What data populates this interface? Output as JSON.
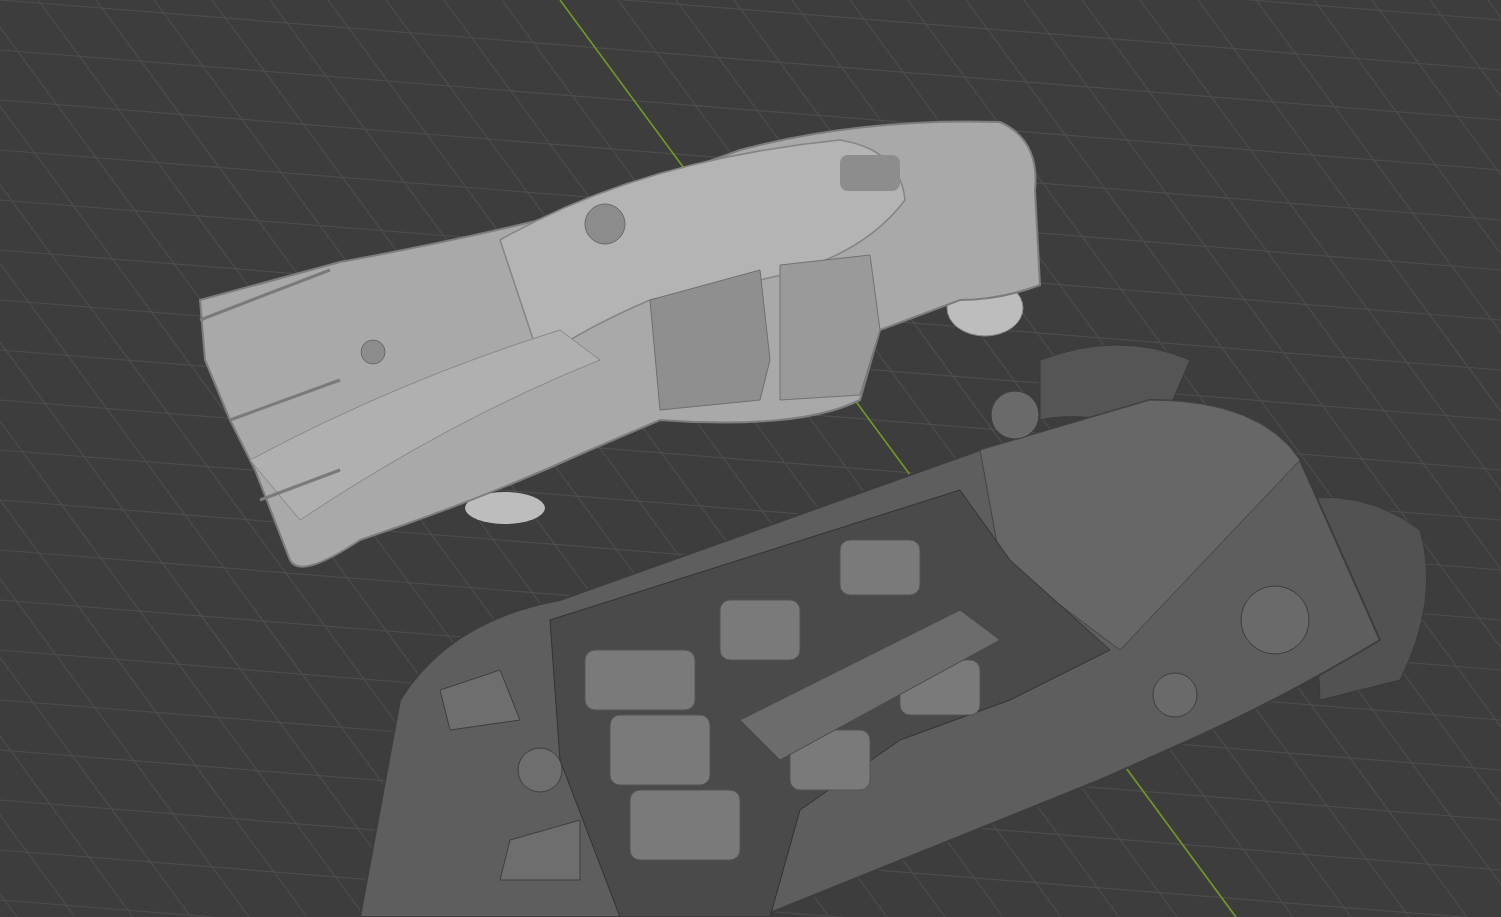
{
  "viewport": {
    "grid": true,
    "y_axis": true
  }
}
